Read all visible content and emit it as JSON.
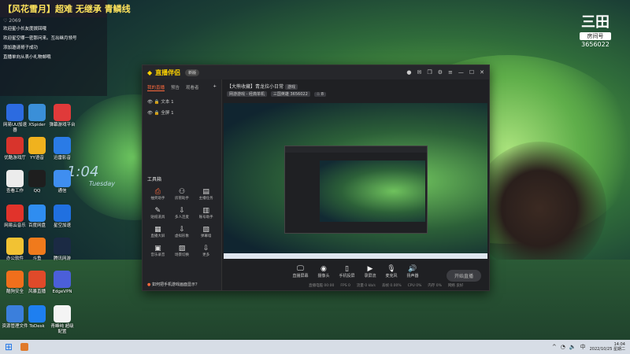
{
  "overlay": {
    "title": "【风花雪月】超难 无继承 青鳞线",
    "stats": "♡ 2069",
    "msgs": [
      "欢迎星小长友度拨回哦",
      "欢迎星空哪一密那问来。互出继月领号",
      "添加邀请哥子成功",
      "直播单向从表小礼物邮哦"
    ]
  },
  "badge": {
    "logo": "三田",
    "tag": "房间号",
    "number": "3656022"
  },
  "desktop": {
    "clock": "1:04",
    "clock_sub": "Tuesday",
    "icons": [
      "网易UU加速器",
      "XSpider",
      "弹幕游戏平台",
      "优酷游戏厅",
      "YY语音",
      "迅雷影音",
      "查看工作",
      "QQ",
      "通信",
      "网易云音乐",
      "百度网盘",
      "星空加速",
      "办公软件",
      "斗鱼",
      "腾讯网游",
      "酷狗安全",
      "风暴直播",
      "EdgeVPN",
      "资源管理文件",
      "ToDesk",
      "青峰纯 超级 配置"
    ]
  },
  "app": {
    "brand": "直播伴侣",
    "version": "新版",
    "tabs": [
      "我的直播",
      "预告",
      "观看者"
    ],
    "sources": [
      "文本 1",
      "全屏 1"
    ],
    "tools_title": "工具箱",
    "tools": [
      "抽奖助手",
      "房管助手",
      "主播任务",
      "贴纸道具",
      "多人连麦",
      "账号助手",
      "直播大屏",
      "虚拟形象",
      "弹幕墙",
      "音乐录音",
      "场景切换",
      "更多"
    ],
    "tip": "如何把手机游戏画面显示？",
    "room_title": "【大熊收藏】青龙拉小日常",
    "room_tag": "游戏",
    "room_pills": [
      "网游游戏 - 经典单机",
      "三国英雄 3656022",
      "♧ 8"
    ],
    "controls": [
      "直播屏幕",
      "摄像头",
      "手机投屏",
      "录屏流",
      "麦克风",
      "扬声器"
    ],
    "start_label": "开始直播",
    "status": [
      "直播电脑 00:00",
      "FPS 0",
      "流量 0 kb/s",
      "丢帧 0.00%",
      "CPU 0%",
      "内存 0%",
      "网络 良好"
    ]
  },
  "taskbar": {
    "time": "14:04",
    "date": "2022/10/25 星期二",
    "lang": "中"
  }
}
